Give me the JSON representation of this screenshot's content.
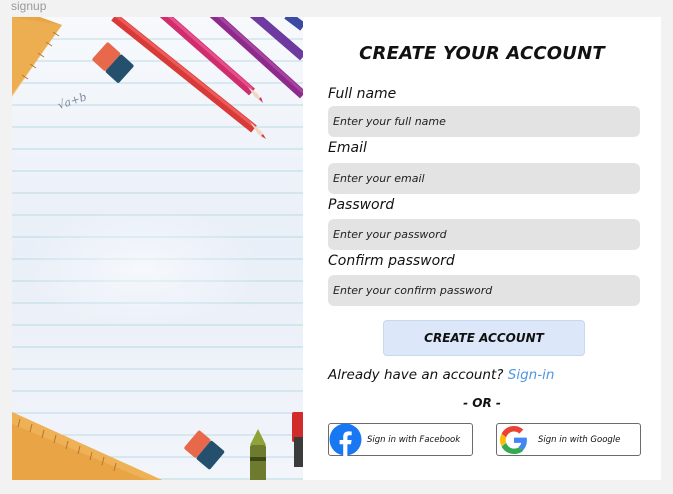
{
  "frame": {
    "label": "signup"
  },
  "form": {
    "title": "CREATE YOUR ACCOUNT",
    "fields": [
      {
        "label": "Full name",
        "placeholder": "Enter your full name"
      },
      {
        "label": "Email",
        "placeholder": "Enter your email"
      },
      {
        "label": "Password",
        "placeholder": "Enter your password"
      },
      {
        "label": "Confirm password",
        "placeholder": "Enter your confirm password"
      }
    ],
    "submit_label": "CREATE ACCOUNT",
    "already_text": "Already have an account?",
    "signin_link": "Sign-in",
    "divider": "- OR -",
    "facebook_label": "Sign in with Facebook",
    "google_label": "Sign in with Google"
  },
  "illustration": {
    "formula": "√a+b"
  },
  "colors": {
    "background": "#f2f2f2",
    "field_bg": "#e3e3e3",
    "button_bg": "#dce8f9",
    "link": "#4f97e6",
    "facebook": "#1877f2",
    "paper": "#eef3fa",
    "paper_line": "#9fcdd8"
  },
  "icons": [
    "facebook-icon",
    "google-icon"
  ]
}
